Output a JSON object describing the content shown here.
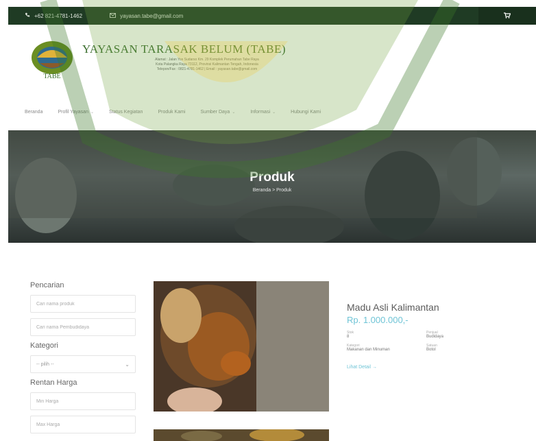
{
  "topbar": {
    "phone": "+62 821-4781-1462",
    "email": "yayasan.tabe@gmail.com",
    "phone_icon": "phone-icon",
    "email_icon": "mail-icon",
    "cart_icon": "cart-icon"
  },
  "brand": {
    "name": "YAYASAN TARASAK BELUM (TABE)",
    "logo_text": "TABE",
    "address_lines": [
      "Alamat : Jalan Yos Sudarso Km. 29 Komplek Perumahan Tabe Raya",
      "Kota Palangka Raya 73112, Provinsi Kalimantan Tengah, Indonesia",
      "Telepon/Fax : 0821-4781-1462 | Email : yayasan.tabe@gmail.com"
    ]
  },
  "nav": {
    "items": [
      {
        "label": "Beranda",
        "dropdown": false
      },
      {
        "label": "Profil Yayasan",
        "dropdown": true
      },
      {
        "label": "Status Kegiatan",
        "dropdown": false
      },
      {
        "label": "Produk Kami",
        "dropdown": false
      },
      {
        "label": "Sumber Daya",
        "dropdown": true
      },
      {
        "label": "Informasi",
        "dropdown": true
      },
      {
        "label": "Hubungi Kami",
        "dropdown": false
      }
    ]
  },
  "hero": {
    "title": "Produk",
    "breadcrumb": "Beranda > Produk"
  },
  "sidebar": {
    "search_heading": "Pencarian",
    "search_product_placeholder": "Cari nama produk",
    "search_seller_placeholder": "Cari nama Pembudidaya",
    "category_heading": "Kategori",
    "category_selected": "-- pilih --",
    "price_heading": "Rentan Harga",
    "min_price_placeholder": "Min Harga",
    "max_price_placeholder": "Max Harga"
  },
  "product": {
    "name": "Madu Asli Kalimantan",
    "price": "Rp. 1.000.000,-",
    "meta": [
      {
        "label": "Stok",
        "value": "8"
      },
      {
        "label": "Penjual",
        "value": "Budidaya"
      },
      {
        "label": "Kategori",
        "value": "Makanan dan Minuman"
      },
      {
        "label": "Satuan",
        "value": "Botol"
      }
    ],
    "detail_link": "Lihat Detail →"
  },
  "colors": {
    "topbar": "#1f3b24",
    "brand_green": "#3b6e2e",
    "accent": "#6fc4d6"
  }
}
